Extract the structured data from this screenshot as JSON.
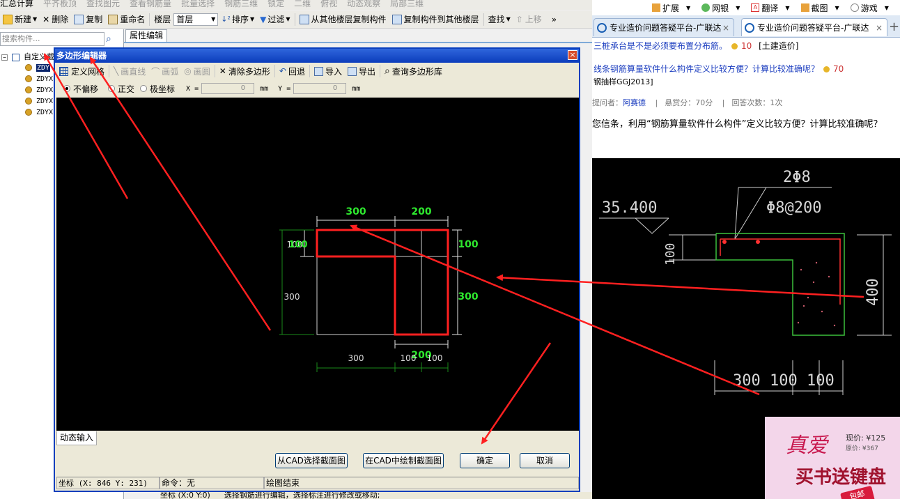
{
  "app": {
    "toolbar1": [
      "汇总计算",
      "平齐板顶",
      "查找图元",
      "查看钢筋量",
      "批量选择",
      "钢筋三维",
      "锁定",
      "二维",
      "俯视",
      "动态观察",
      "局部三维"
    ],
    "toolbar2": {
      "new_label": "新建",
      "delete_label": "删除",
      "copy_label": "复制",
      "rename_label": "重命名",
      "floor_label": "楼层",
      "floor_value": "首层",
      "sort_label": "排序",
      "filter_label": "过滤",
      "copy_from_label": "从其他楼层复制构件",
      "copy_to_label": "复制构件到其他楼层",
      "find_label": "查找",
      "move_up_label": "上移"
    },
    "search_placeholder": "搜索构件...",
    "tree": {
      "root_label": "自定义截",
      "items": [
        "ZDY",
        "ZDYX",
        "ZDYX",
        "ZDYX",
        "ZDYX"
      ]
    },
    "property_tab": "属性编辑",
    "bottom_status": [
      "坐标 (X:0 Y:0)",
      "选择钢筋进行编辑，选择标注进行修改或移动;"
    ]
  },
  "dialog": {
    "title": "多边形编辑器",
    "close_glyph": "×",
    "toolbar": {
      "define_grid": "定义网格",
      "line": "画直线",
      "arc": "画弧",
      "circle": "画圆",
      "clear": "清除多边形",
      "undo": "回退",
      "import": "导入",
      "export": "导出",
      "query": "查询多边形库"
    },
    "mode": {
      "no_offset": "不偏移",
      "ortho": "正交",
      "polar": "极坐标",
      "x_label": "X =",
      "x_value": "0",
      "y_label": "Y =",
      "y_value": "0",
      "unit": "mm"
    },
    "canvas_dims": {
      "top_left": "300",
      "top_right": "200",
      "left_small": "100",
      "left_small_overlap": "100",
      "left_big": "300",
      "right_small": "100",
      "right_big": "300",
      "bottom_1": "300",
      "bottom_2": "100",
      "bottom_3": "100",
      "bottom_green": "200"
    },
    "dynamic_input_tab": "动态输入",
    "buttons": {
      "from_cad": "从CAD选择截面图",
      "draw_in_cad": "在CAD中绘制截面图",
      "ok": "确定",
      "cancel": "取消"
    },
    "status": {
      "coord": "坐标 (X: 846 Y: 231)",
      "command": "命令：无",
      "message": "绘图结束"
    }
  },
  "browser": {
    "top_items": [
      "扩展",
      "网银",
      "翻译",
      "截图",
      "游戏"
    ],
    "tabs": [
      "专业造价问题答疑平台-广联达",
      "专业造价问题答疑平台-广联达"
    ],
    "new_tab_glyph": "+",
    "question1": {
      "text": "三桩承台是不是必须要布置分布筋。",
      "points": "10",
      "category": "[土建造价]"
    },
    "question2": {
      "text": "线条钢筋算量软件什么构件定义比较方便？计算比较准确呢？",
      "points": "70"
    },
    "question2_sub": "钢抽样GGJ2013]",
    "meta": {
      "asker_label": "提问者：",
      "asker": "阿赛德",
      "reward": "悬赏分：70分",
      "answers": "回答次数：1次"
    },
    "body": "您信条，利用“钢筋算量软件什么构件”定义比较方便？计算比较准确呢？",
    "drawing": {
      "elevation": "35.400",
      "rebar_top": "2Φ8",
      "rebar_stirrup": "Φ8@200",
      "dim_100": "100",
      "dim_400": "400",
      "dim_bottom": "300  100 100"
    },
    "ad": {
      "title": "真爱",
      "price_now": "现价: ¥125",
      "price_orig": "原价: ¥367",
      "slogan": "买书送键盘",
      "badge": "包邮"
    }
  },
  "colors": {
    "red": "#ff2020",
    "green": "#00c800",
    "dim_green": "#2ee82e",
    "title_blue": "#0b3cbb"
  }
}
